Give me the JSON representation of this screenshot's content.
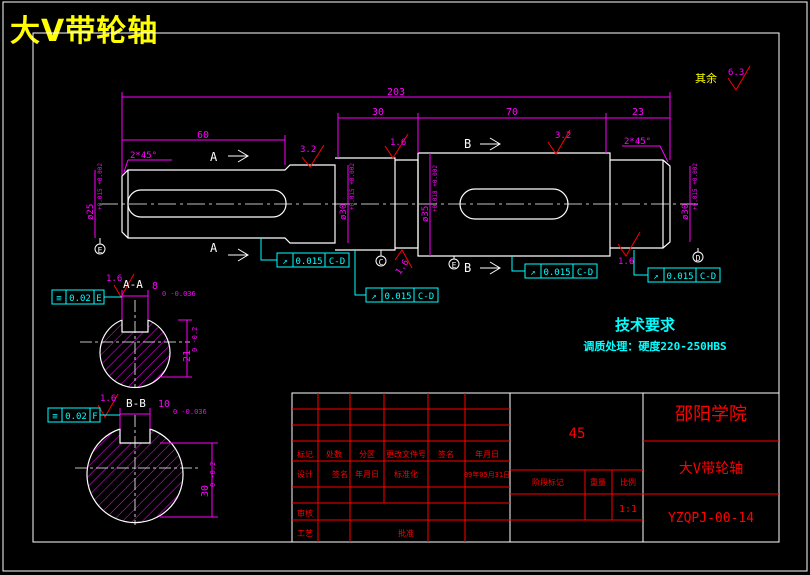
{
  "title": "大V带轮轴",
  "colors": {
    "background": "#000000",
    "outline": "#ffffff",
    "dimension": "#ff00ff",
    "centerline": "#ffffff",
    "symbol": "#00ffff",
    "roughness": "#ff0000",
    "title_block": "#ff0000",
    "hatch": "#ff00ff"
  },
  "dimensions": {
    "overall": "203",
    "left_segment": "60",
    "seg_30": "30",
    "seg_70": "70",
    "seg_23": "23",
    "chamfer_left": "2*45°",
    "chamfer_right": "2*45°",
    "dia_left": "ø25",
    "dia_left_tol": "+0.015 +0.002",
    "dia_30a": "ø30",
    "dia_30a_tol": "+0.015 +0.002",
    "dia_35": "ø35",
    "dia_35_tol": "+0.018 +0.002",
    "dia_30b": "ø30",
    "dia_30b_tol": "+0.015 +0.002"
  },
  "roughness": {
    "other": "其余",
    "other_value": "6.3",
    "r1": "3.2",
    "r2": "1.6",
    "r3": "3.2",
    "r4": "1.6",
    "r5": "1.6",
    "r6": "1.6",
    "r7": "1.6"
  },
  "datums": {
    "c": "C",
    "d": "D",
    "e": "E",
    "f": "F"
  },
  "sections": {
    "a_label": "A",
    "b_label": "B",
    "aa": "A-A",
    "bb": "B-B",
    "aa_width": "8",
    "aa_width_tol": "0 -0.036",
    "aa_depth": "21",
    "aa_depth_tol": "0 -0.2",
    "bb_width": "10",
    "bb_width_tol": "0 -0.036",
    "bb_depth": "30",
    "bb_depth_tol": "0 -0.2"
  },
  "tolerance_frames": [
    {
      "symbol": "↗",
      "value": "0.015",
      "datum": "C-D"
    },
    {
      "symbol": "↗",
      "value": "0.015",
      "datum": "C-D"
    },
    {
      "symbol": "↗",
      "value": "0.015",
      "datum": "C-D"
    },
    {
      "symbol": "↗",
      "value": "0.015",
      "datum": "C-D"
    }
  ],
  "symmetry_frames": [
    {
      "symbol": "≡",
      "value": "0.02",
      "datum": "E"
    },
    {
      "symbol": "≡",
      "value": "0.02",
      "datum": "F"
    }
  ],
  "tech_req": {
    "heading": "技术要求",
    "line1": "调质处理：硬度220-250HBS"
  },
  "title_block": {
    "material": "45",
    "school": "邵阳学院",
    "part_name": "大V带轮轴",
    "drawing_no": "YZQPJ-00-14",
    "scale": "1:1",
    "row_labels_a": [
      "标记",
      "处数",
      "分区",
      "更改文件号",
      "签名",
      "年月日"
    ],
    "row_labels_b": [
      "设计",
      "",
      "标准化",
      "",
      "",
      ""
    ],
    "sign_date": "09年05月31日",
    "stage_label": "阶段标记",
    "weight_label": "重量",
    "ratio_label": "比例",
    "audit": "审核",
    "process": "工艺",
    "approve": "批准"
  }
}
